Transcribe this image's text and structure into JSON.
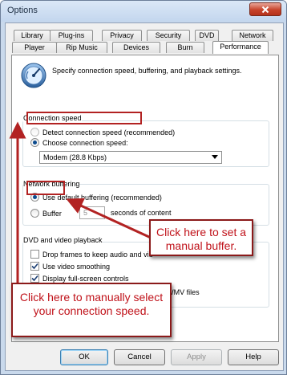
{
  "window": {
    "title": "Options",
    "close_icon": "close-icon"
  },
  "tabs_row1": [
    "Library",
    "Plug-ins",
    "Privacy",
    "Security",
    "DVD",
    "Network"
  ],
  "tabs_row2": [
    "Player",
    "Rip Music",
    "Devices",
    "Burn",
    "Performance"
  ],
  "active_tab": "Performance",
  "intro_text": "Specify connection speed, buffering, and playback settings.",
  "connection_speed": {
    "title": "Connection speed",
    "detect_label": "Detect connection speed (recommended)",
    "choose_label": "Choose connection speed:",
    "selected": "choose",
    "speed_value": "Modem (28.8 Kbps)"
  },
  "network_buffering": {
    "title": "Network buffering",
    "default_label": "Use default buffering (recommended)",
    "buffer_label": "Buffer",
    "buffer_value": "5",
    "seconds_label": "seconds of content",
    "selected": "default"
  },
  "dvd_video": {
    "title": "DVD and video playback",
    "items": [
      {
        "label": "Drop frames to keep audio and vid",
        "checked": false
      },
      {
        "label": "Use video smoothing",
        "checked": true
      },
      {
        "label": "Display full-screen controls",
        "checked": true
      },
      {
        "label": "Turn on DirectX Video Acceleration for WMV files",
        "checked": true
      }
    ]
  },
  "buttons": {
    "ok": "OK",
    "cancel": "Cancel",
    "apply": "Apply",
    "help": "Help"
  },
  "callouts": {
    "buffer": "Click here to set a manual buffer.",
    "connection": "Click here to manually select your connection speed."
  },
  "colors": {
    "annotation_red": "#c0121a",
    "arrow_red": "#b22222",
    "frame_blue": "#c9d9ec"
  }
}
